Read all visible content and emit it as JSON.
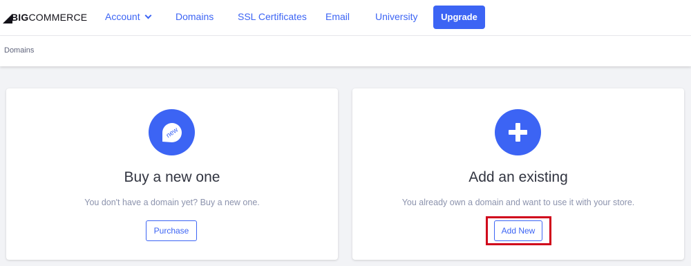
{
  "brand": {
    "logo_text_bold": "BIG",
    "logo_text_light": "COMMERCE"
  },
  "nav": {
    "account": "Account",
    "domains": "Domains",
    "ssl": "SSL Certificates",
    "email": "Email",
    "university": "University",
    "upgrade": "Upgrade"
  },
  "breadcrumb": "Domains",
  "cards": {
    "buy": {
      "icon": "new-badge-icon",
      "icon_text": "new",
      "title": "Buy a new one",
      "description": "You don't have a domain yet? Buy a new one.",
      "button": "Purchase"
    },
    "existing": {
      "icon": "plus-icon",
      "title": "Add an existing",
      "description": "You already own a domain and want to use it with your store.",
      "button": "Add New"
    }
  },
  "colors": {
    "accent": "#3c64f4",
    "highlight": "#d0021b",
    "background": "#f2f3f6"
  }
}
